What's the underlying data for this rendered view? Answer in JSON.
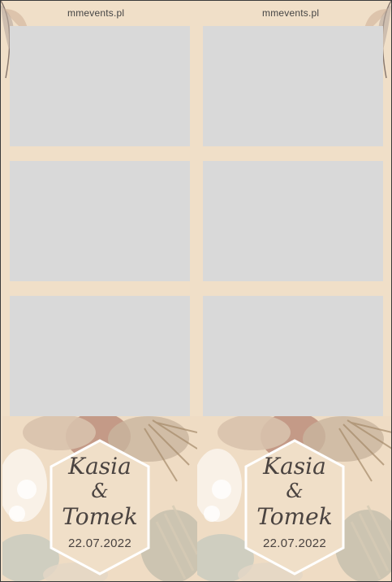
{
  "header": {
    "site_left": "mmevents.pl",
    "site_right": "mmevents.pl"
  },
  "photo_slots": [
    {
      "name": "photo-slot-1"
    },
    {
      "name": "photo-slot-2"
    },
    {
      "name": "photo-slot-3"
    },
    {
      "name": "photo-slot-4"
    },
    {
      "name": "photo-slot-5"
    },
    {
      "name": "photo-slot-6"
    }
  ],
  "badge_left": {
    "name1": "Kasia",
    "amp": "&",
    "name2": "Tomek",
    "date": "22.07.2022"
  },
  "badge_right": {
    "name1": "Kasia",
    "amp": "&",
    "name2": "Tomek",
    "date": "22.07.2022"
  },
  "colors": {
    "background": "#f0dfc8",
    "photo_placeholder": "#d9d9d9",
    "badge_fill": "#f0dfc8",
    "text": "#4a4340"
  }
}
